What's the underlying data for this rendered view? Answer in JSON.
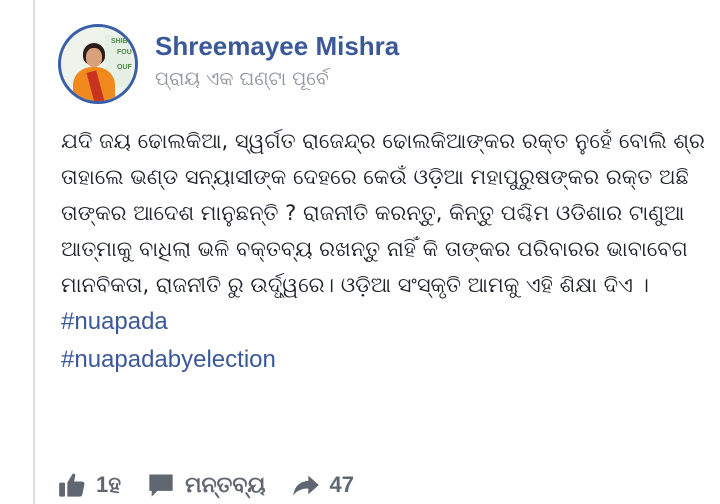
{
  "post": {
    "author": "Shreemayee Mishra",
    "timestamp": "ପ୍ରାୟ ଏକ ଘଣ୍ଟା ପୂର୍ବେ",
    "avatar_text": [
      "SHIB",
      "FOU",
      "OUF"
    ],
    "body_lines": [
      "ଯଦି ଜୟ ଢୋଲକିଆ, ସ୍ୱର୍ଗତ ରାଜେନ୍ଦ୍ର ଢୋଲକିଆଙ୍କର ରକ୍ତ ନୁହେଁ ବୋଲି ଶ୍ର",
      "ତାହାଲେ ଭଣ୍ଡ ସନ୍ୟାସୀଙ୍କ ଦେହରେ କେଉଁ ଓଡ଼ିଆ ମହାପୁରୁଷଙ୍କର ରକ୍ତ ଅଛି",
      "ତାଙ୍କର ଆଦେଶ ମାନୁଛନ୍ତି ? ରାଜନୀତି କରନ୍ତୁ, କିନ୍ତୁ ପଶ୍ଚିମ ଓଡିଶାର ଟାଣୁଆ",
      "ଆତ୍ମାକୁ ବାଧିଲା ଭଳି ବକ୍ତବ୍ୟ ରଖନ୍ତୁ ନାହିଁ କି ତାଙ୍କର ପରିବାରର ଭାବାବେଗ",
      "ମାନବିକତା, ରାଜନୀତି ରୁ ଉର୍ଦ୍ଧ୍ୱରେ। ଓଡ଼ିଆ ସଂସ୍କୃତି ଆମକୁ ଏହି ଶିକ୍ଷା ଦିଏ ।"
    ],
    "hashtags": [
      "#nuapada",
      "#nuapadabyelection"
    ]
  },
  "actions": {
    "like_label": "1ହ",
    "comment_label": "ମନ୍ତବ୍ୟ",
    "share_count": "47"
  },
  "colors": {
    "author": "#3b5998",
    "hashtag": "#3b5998",
    "body_text": "#1d2129",
    "meta_text": "#90949c",
    "action_icon": "#606770"
  },
  "icons": {
    "like": "thumbs-up-icon",
    "comment": "speech-bubble-icon",
    "share": "share-arrow-icon"
  }
}
